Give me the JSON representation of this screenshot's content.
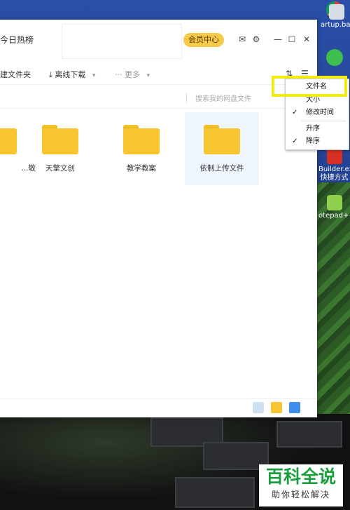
{
  "window": {
    "title": "今日热榜",
    "vip_label": "会员中心",
    "icons": [
      "mail-icon",
      "settings-icon",
      "minimize-icon",
      "maximize-icon",
      "close-icon"
    ]
  },
  "toolbar": {
    "new_folder": "建文件夹",
    "offline_download": "离线下载",
    "more": "更多"
  },
  "search": {
    "placeholder": "搜索我的网盘文件"
  },
  "folders": [
    {
      "name": "...敬"
    },
    {
      "name": "天擎文创"
    },
    {
      "name": "教学教案"
    },
    {
      "name": "依制上传文件"
    }
  ],
  "sort_menu": {
    "items": [
      {
        "label": "文件名",
        "checked": false
      },
      {
        "label": "大小",
        "checked": false
      },
      {
        "label": "修改时间",
        "checked": true
      },
      {
        "label": "升序",
        "checked": false
      },
      {
        "label": "降序",
        "checked": true
      }
    ],
    "check_glyph": "✓"
  },
  "desktop": {
    "icons": [
      {
        "label": "",
        "icon": "chrome-icon"
      },
      {
        "label": "artup.bat",
        "icon": "bat-file-icon"
      },
      {
        "label": "Builder.exe 快捷方式",
        "icon": "app-shortcut-icon"
      },
      {
        "label": "otepad++",
        "icon": "notepadpp-icon"
      }
    ]
  },
  "watermark": {
    "title": "百科全说",
    "subtitle": "助你轻松解决"
  },
  "colors": {
    "highlight": "#f2ea14",
    "folder": "#f7c52f",
    "vip": "#f5c94a",
    "brand_green": "#1a9e3e"
  }
}
